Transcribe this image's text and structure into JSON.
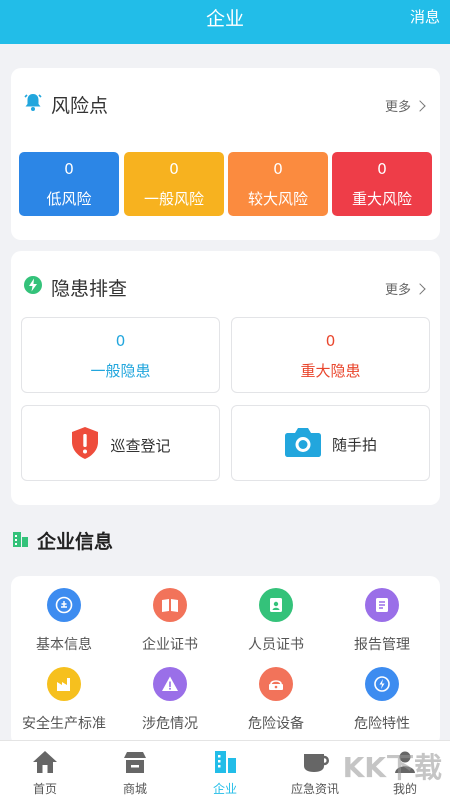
{
  "header": {
    "title": "企业",
    "message_label": "消息"
  },
  "risk_card": {
    "title": "风险点",
    "more_label": "更多",
    "items": [
      {
        "value": "0",
        "label": "低风险",
        "color": "#2c86e6"
      },
      {
        "value": "0",
        "label": "一般风险",
        "color": "#f7b21f"
      },
      {
        "value": "0",
        "label": "较大风险",
        "color": "#fb8b3f"
      },
      {
        "value": "0",
        "label": "重大风险",
        "color": "#ee3d48"
      }
    ]
  },
  "hazard_card": {
    "title": "隐患排查",
    "more_label": "更多",
    "general": {
      "value": "0",
      "label": "一般隐患",
      "color": "#22a6dd"
    },
    "major": {
      "value": "0",
      "label": "重大隐患",
      "color": "#e9462d"
    },
    "patrol_label": "巡查登记",
    "snapshot_label": "随手拍"
  },
  "company_section": {
    "title": "企业信息",
    "items": [
      {
        "label": "基本信息",
        "icon": "info-icon",
        "color": "#3d8cf0"
      },
      {
        "label": "企业证书",
        "icon": "book-icon",
        "color": "#f2735a"
      },
      {
        "label": "人员证书",
        "icon": "person-cert-icon",
        "color": "#34c27a"
      },
      {
        "label": "报告管理",
        "icon": "report-icon",
        "color": "#9a6fe8"
      },
      {
        "label": "安全生产标准",
        "icon": "factory-icon",
        "color": "#f6c01e"
      },
      {
        "label": "涉危情况",
        "icon": "warning-icon",
        "color": "#9a6fe8"
      },
      {
        "label": "危险设备",
        "icon": "device-icon",
        "color": "#f2735a"
      },
      {
        "label": "危险特性",
        "icon": "hazard-icon",
        "color": "#3d8cf0"
      }
    ]
  },
  "tabbar": {
    "tabs": [
      {
        "label": "首页",
        "icon": "home-icon"
      },
      {
        "label": "商城",
        "icon": "shop-icon"
      },
      {
        "label": "企业",
        "icon": "building-icon",
        "active": true
      },
      {
        "label": "应急资讯",
        "icon": "news-icon"
      },
      {
        "label": "我的",
        "icon": "user-icon"
      }
    ]
  },
  "watermark": "KK下载",
  "colors": {
    "primary": "#22bde8",
    "background": "#f1f2f5"
  }
}
